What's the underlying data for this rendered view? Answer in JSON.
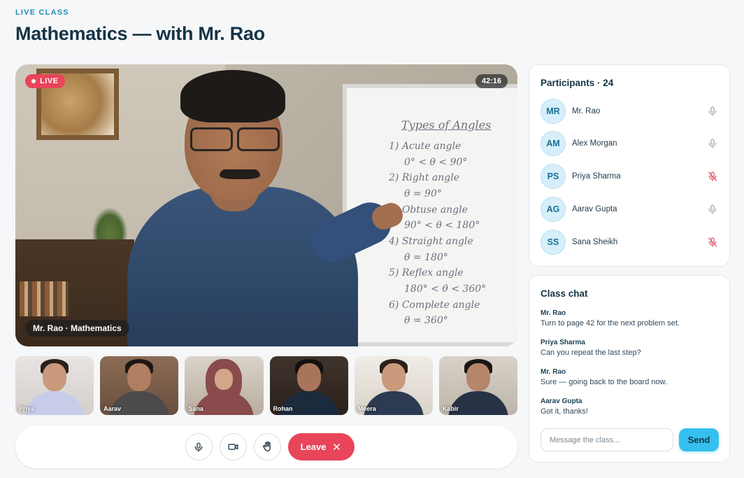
{
  "header": {
    "eyebrow": "LIVE CLASS",
    "title": "Mathematics — with Mr. Rao"
  },
  "stage": {
    "live_label": "LIVE",
    "timer": "42:16",
    "speaker_label": "Mr. Rao · Mathematics",
    "board": {
      "title": "Types of Angles",
      "lines": [
        "1) Acute angle",
        "0° < θ < 90°",
        "2) Right angle",
        "θ = 90°",
        "3) Obtuse angle",
        "90° < θ < 180°",
        "4) Straight angle",
        "θ = 180°",
        "5) Reflex angle",
        "180° < θ < 360°",
        "6) Complete angle",
        "θ = 360°"
      ]
    }
  },
  "thumbnails": [
    {
      "name": "Priya"
    },
    {
      "name": "Aarav"
    },
    {
      "name": "Sana"
    },
    {
      "name": "Rohan"
    },
    {
      "name": "Meera"
    },
    {
      "name": "Kabir"
    }
  ],
  "controls": {
    "mic_icon": "mic-icon",
    "camera_icon": "camera-icon",
    "hand_icon": "raise-hand-icon",
    "leave_label": "Leave"
  },
  "participants": {
    "title": "Participants · 24",
    "list": [
      {
        "initials": "MR",
        "name": "Mr. Rao",
        "muted": false
      },
      {
        "initials": "AM",
        "name": "Alex Morgan",
        "muted": false
      },
      {
        "initials": "PS",
        "name": "Priya Sharma",
        "muted": true
      },
      {
        "initials": "AG",
        "name": "Aarav Gupta",
        "muted": false
      },
      {
        "initials": "SS",
        "name": "Sana Sheikh",
        "muted": true
      }
    ]
  },
  "chat": {
    "title": "Class chat",
    "messages": [
      {
        "author": "Mr. Rao",
        "text": "Turn to page 42 for the next problem set."
      },
      {
        "author": "Priya Sharma",
        "text": "Can you repeat the last step?"
      },
      {
        "author": "Mr. Rao",
        "text": "Sure — going back to the board now."
      },
      {
        "author": "Aarav Gupta",
        "text": "Got it, thanks!"
      }
    ],
    "input_placeholder": "Message the class...",
    "send_label": "Send"
  },
  "colors": {
    "accent": "#35bfee",
    "live_red": "#e8455a",
    "muted_red": "#e8455a",
    "mic_gray": "#9aa5ae"
  }
}
